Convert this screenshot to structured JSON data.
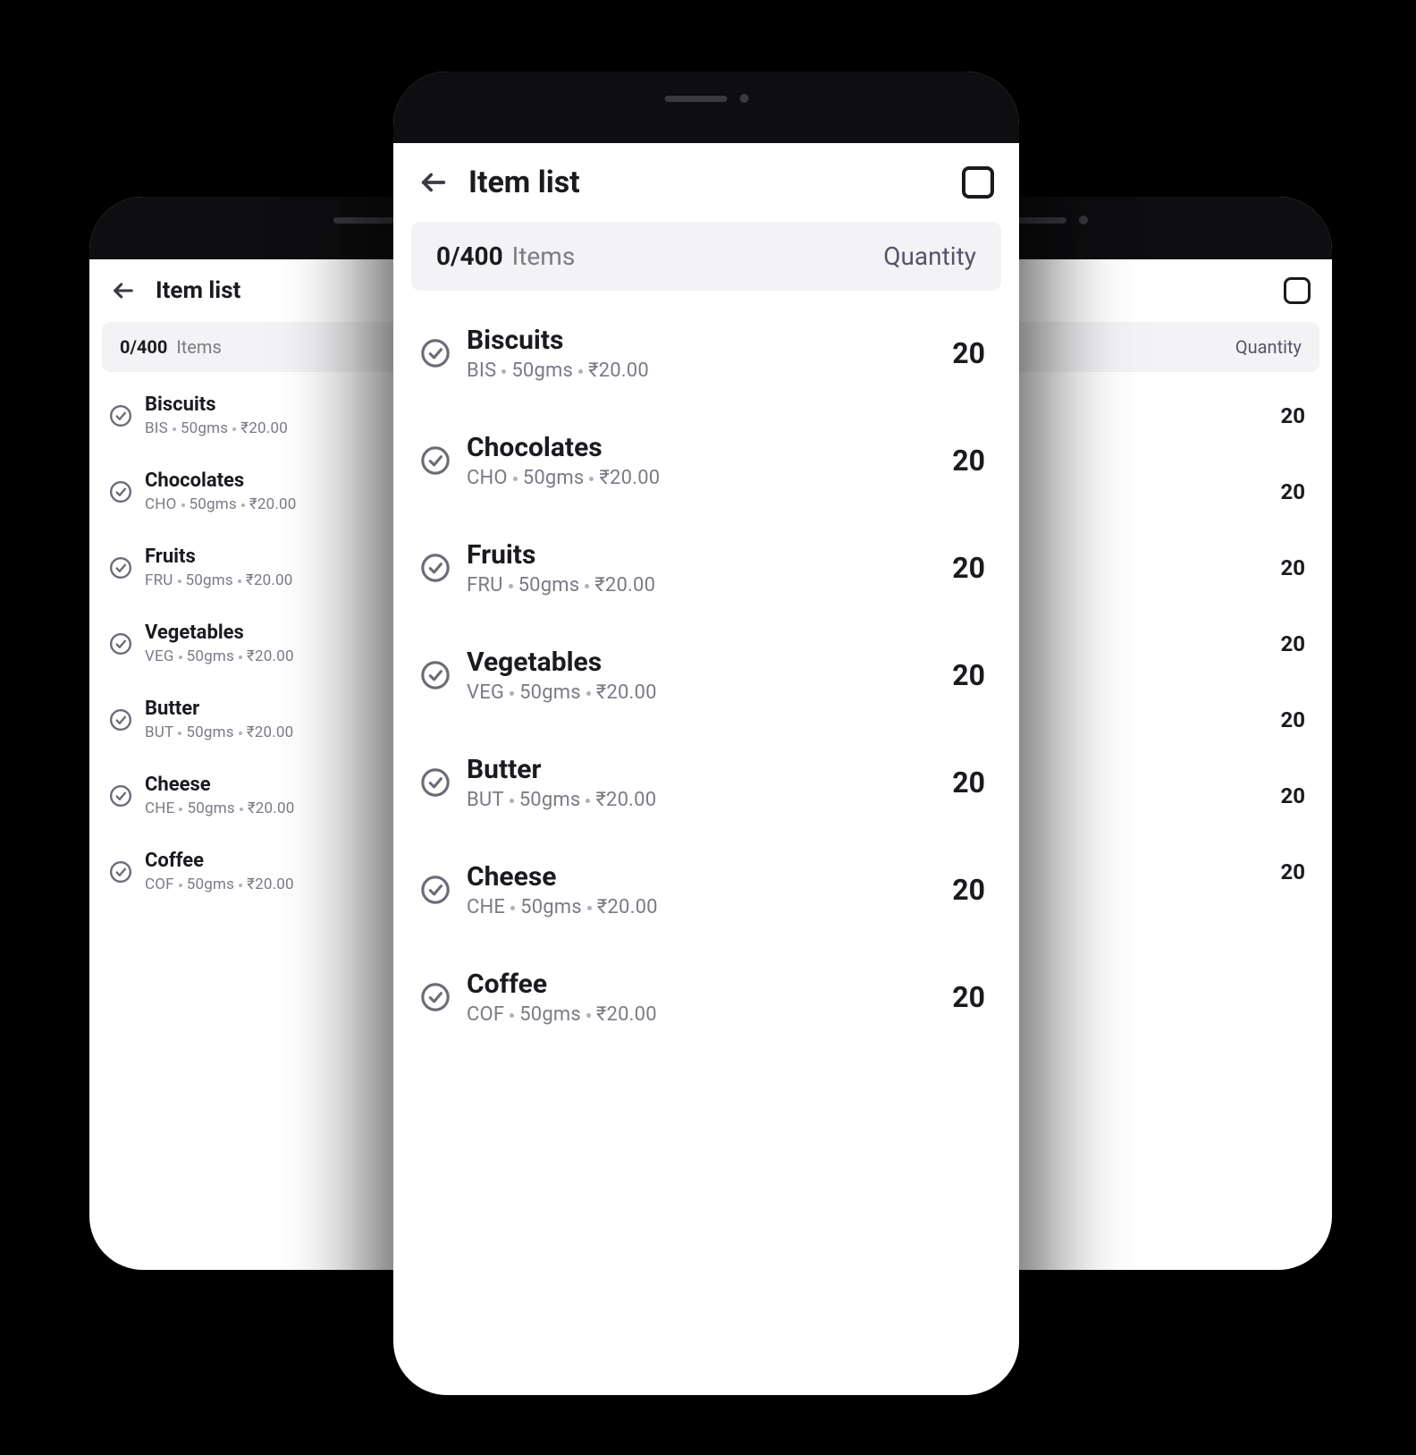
{
  "header": {
    "title": "Item list"
  },
  "summary": {
    "count": "0/400",
    "items_label": "Items",
    "quantity_label": "Quantity"
  },
  "items": [
    {
      "name": "Biscuits",
      "code": "BIS",
      "weight": "50gms",
      "price": "₹20.00",
      "quantity": "20"
    },
    {
      "name": "Chocolates",
      "code": "CHO",
      "weight": "50gms",
      "price": "₹20.00",
      "quantity": "20"
    },
    {
      "name": "Fruits",
      "code": "FRU",
      "weight": "50gms",
      "price": "₹20.00",
      "quantity": "20"
    },
    {
      "name": "Vegetables",
      "code": "VEG",
      "weight": "50gms",
      "price": "₹20.00",
      "quantity": "20"
    },
    {
      "name": "Butter",
      "code": "BUT",
      "weight": "50gms",
      "price": "₹20.00",
      "quantity": "20"
    },
    {
      "name": "Cheese",
      "code": "CHE",
      "weight": "50gms",
      "price": "₹20.00",
      "quantity": "20"
    },
    {
      "name": "Coffee",
      "code": "COF",
      "weight": "50gms",
      "price": "₹20.00",
      "quantity": "20"
    }
  ]
}
